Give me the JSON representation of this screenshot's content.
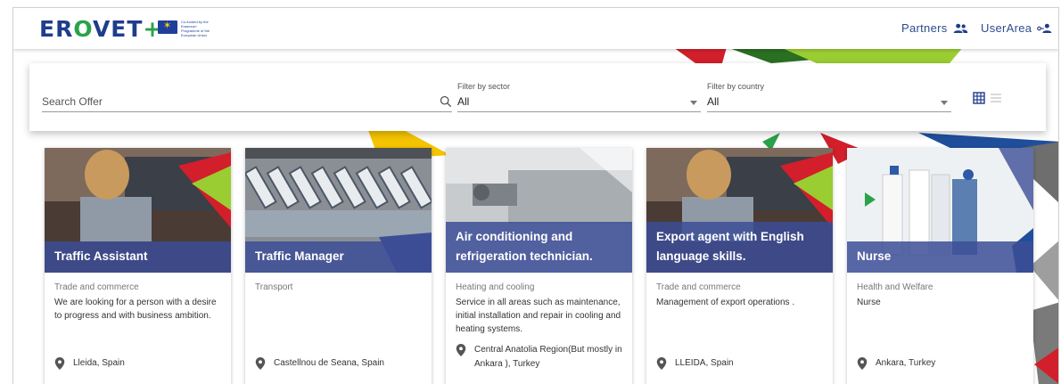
{
  "header": {
    "logo_text": "EROVET+",
    "eu_funding_text": "Co-funded by the Erasmus+ Programme of the European Union",
    "partners_label": "Partners",
    "userarea_label": "UserArea"
  },
  "filters": {
    "search_placeholder": "Search Offer",
    "sector_label": "Filter by sector",
    "sector_value": "All",
    "country_label": "Filter by country",
    "country_value": "All"
  },
  "cards": [
    {
      "title": "Traffic Assistant",
      "sector": "Trade and commerce",
      "description": "We are looking for a person with a desire to progress and with business ambition.",
      "location": "Lleida, Spain"
    },
    {
      "title": "Traffic Manager",
      "sector": "Transport",
      "description": "",
      "location": "Castellnou de Seana, Spain"
    },
    {
      "title": "Air conditioning and refrigeration technician.",
      "sector": "Heating and cooling",
      "description": "Service in all areas such as maintenance, initial installation and repair in cooling and heating systems.",
      "location": "Central Anatolia Region(But mostly in Ankara ), Turkey"
    },
    {
      "title": "Export agent with English language skills.",
      "sector": "Trade and commerce",
      "description": "Management of export operations .",
      "location": "LLEIDA, Spain"
    },
    {
      "title": "Nurse",
      "sector": "Health and Welfare",
      "description": "Nurse",
      "location": "Ankara, Turkey"
    }
  ],
  "colors": {
    "brand_blue": "#1f3d8c",
    "brand_green": "#2aa24a",
    "overlay_blue": "#3c4e96",
    "accent_red": "#d21f2b",
    "accent_yellow": "#f5c400"
  },
  "icons": [
    "people-icon",
    "user-key-icon",
    "search-icon",
    "caret-down-icon",
    "grid-view-icon",
    "list-view-icon",
    "location-pin-icon"
  ]
}
